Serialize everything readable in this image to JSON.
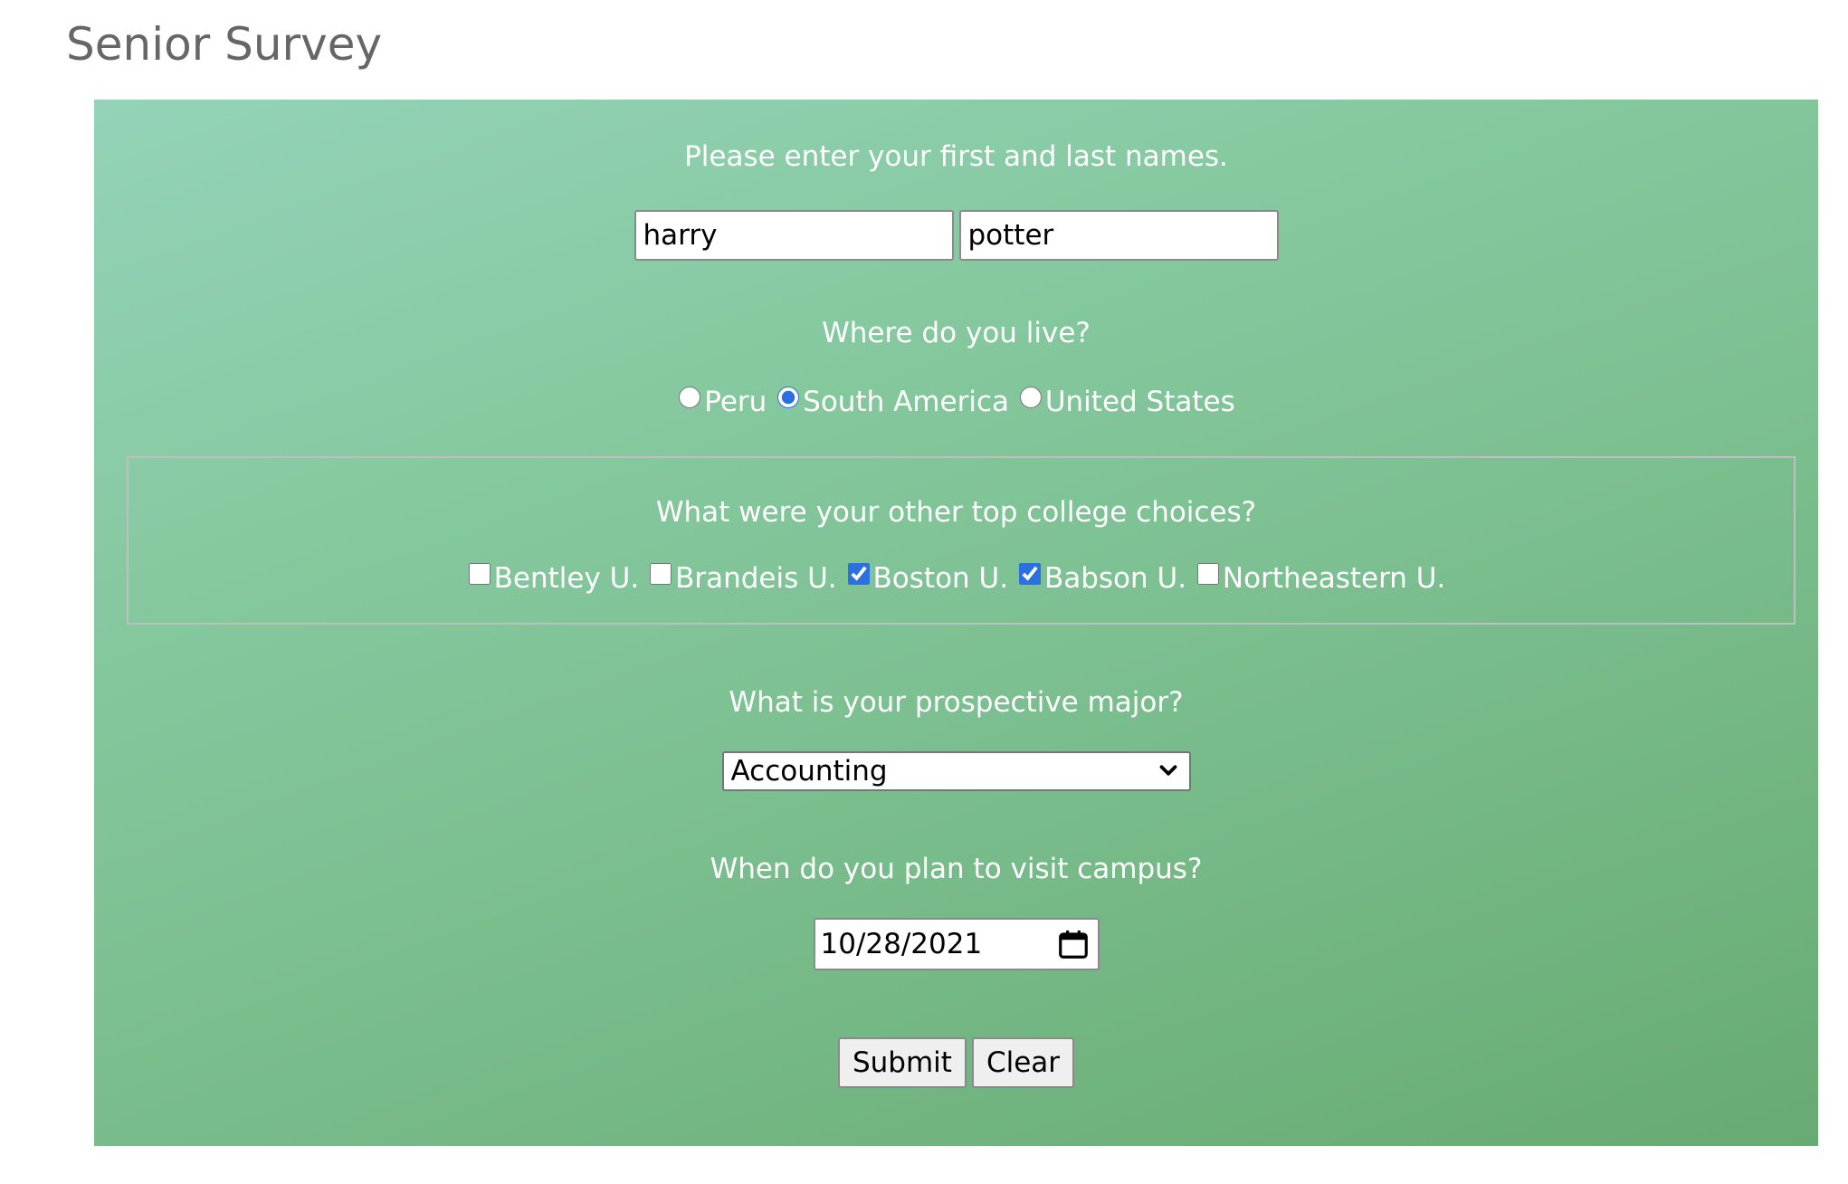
{
  "page": {
    "title": "Senior Survey"
  },
  "name_section": {
    "question": "Please enter your first and last names.",
    "first_name_value": "harry",
    "last_name_value": "potter"
  },
  "residence": {
    "question": "Where do you live?",
    "options": [
      {
        "label": "Peru",
        "checked": false
      },
      {
        "label": "South America",
        "checked": true
      },
      {
        "label": "United States",
        "checked": false
      }
    ]
  },
  "colleges": {
    "question": "What were your other top college choices?",
    "options": [
      {
        "label": "Bentley U.",
        "checked": false
      },
      {
        "label": "Brandeis U.",
        "checked": false
      },
      {
        "label": "Boston U.",
        "checked": true
      },
      {
        "label": "Babson U.",
        "checked": true
      },
      {
        "label": "Northeastern U.",
        "checked": false
      }
    ]
  },
  "major": {
    "question": "What is your prospective major?",
    "selected": "Accounting",
    "icon": "chevron-down-icon"
  },
  "visit": {
    "question": "When do you plan to visit campus?",
    "date_value": "10/28/2021",
    "icon": "calendar-icon"
  },
  "buttons": {
    "submit_label": "Submit",
    "clear_label": "Clear"
  },
  "colors": {
    "panel_gradient_start": "#94d3b8",
    "panel_gradient_end": "#67ab72",
    "question_text": "#ffffff",
    "title_text": "#666666",
    "accent": "#2b6fe0"
  }
}
